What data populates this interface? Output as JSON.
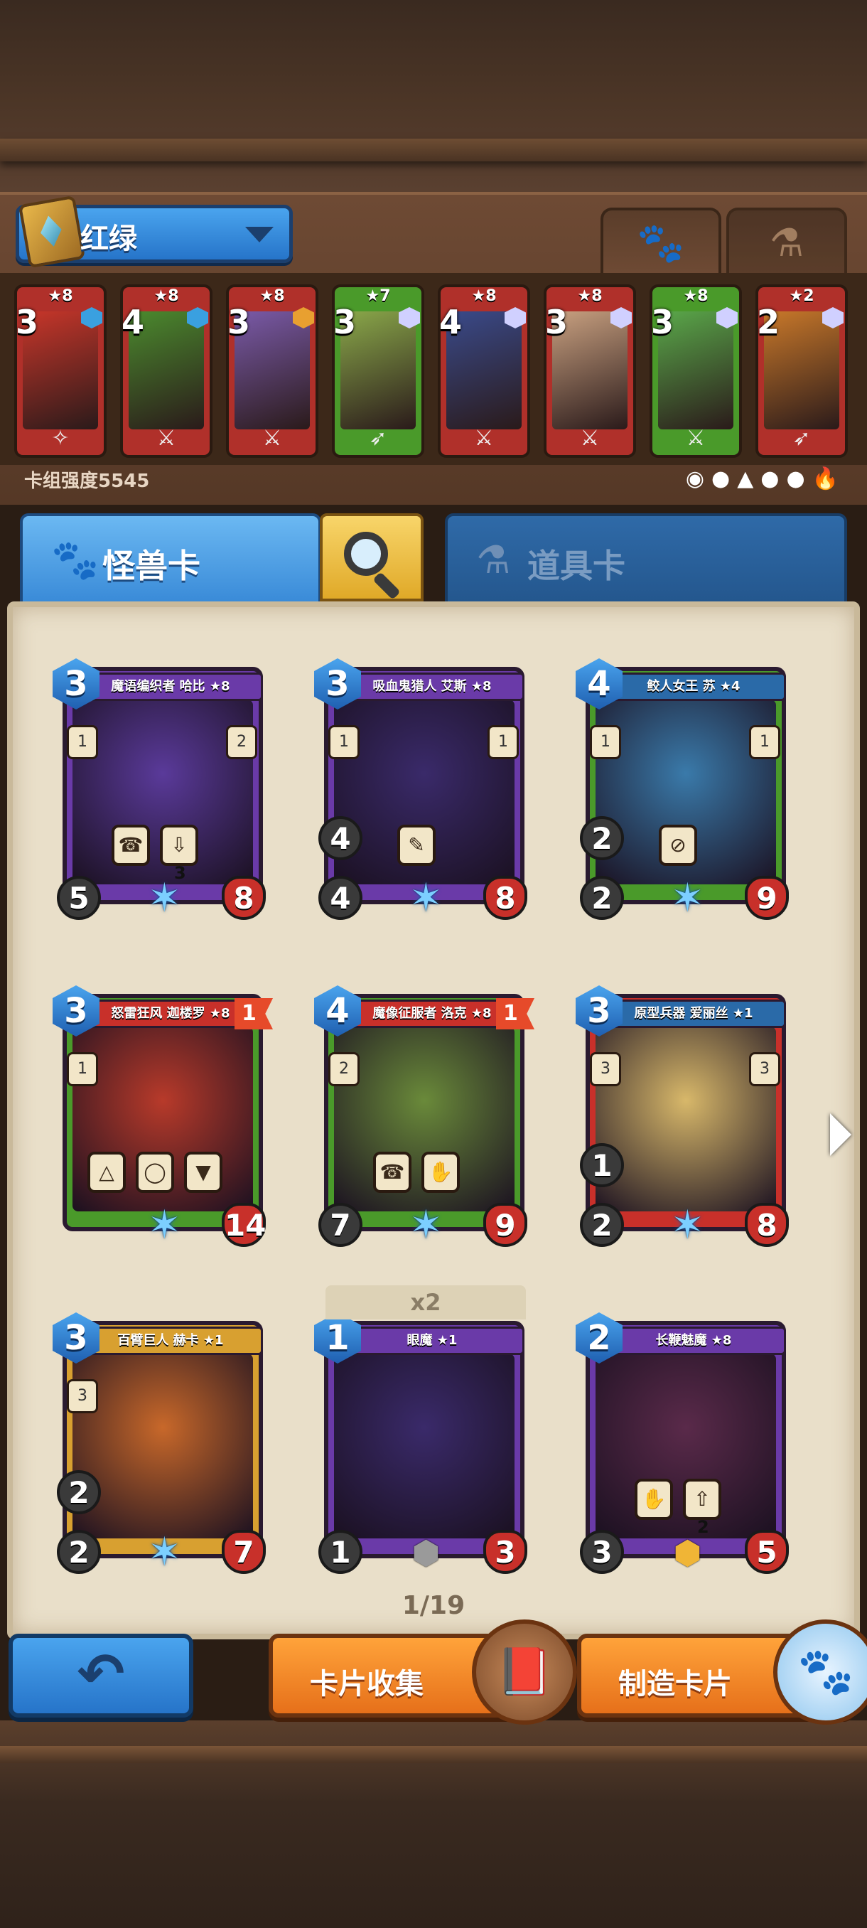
{
  "header": {
    "deck_name": "红绿",
    "tab_monster_icon": "paw-icon",
    "tab_item_icon": "potion-icon"
  },
  "deck": {
    "strength_label": "卡组强度5545",
    "cards": [
      {
        "stars": "★8",
        "cost": "3",
        "art_color": "#c8362a",
        "frame": "#b0302a",
        "gem": "#3aa0e0",
        "weapon": "paw"
      },
      {
        "stars": "★8",
        "cost": "4",
        "art_color": "#4b8a2e",
        "frame": "#b0302a",
        "gem": "#3aa0e0",
        "weapon": "sword"
      },
      {
        "stars": "★8",
        "cost": "3",
        "art_color": "#7a5aa8",
        "frame": "#b0302a",
        "gem": "#e8a030",
        "weapon": "sword"
      },
      {
        "stars": "★7",
        "cost": "3",
        "art_color": "#8aa84a",
        "frame": "#4a9a2a",
        "gem": "#d0d0ff",
        "weapon": "bow"
      },
      {
        "stars": "★8",
        "cost": "4",
        "art_color": "#3a4a8a",
        "frame": "#b0302a",
        "gem": "#d0d0ff",
        "weapon": "sword"
      },
      {
        "stars": "★8",
        "cost": "3",
        "art_color": "#c8a080",
        "frame": "#b0302a",
        "gem": "#d0d0ff",
        "weapon": "sword"
      },
      {
        "stars": "★8",
        "cost": "3",
        "art_color": "#5aa84a",
        "frame": "#4a9a2a",
        "gem": "#d0d0ff",
        "weapon": "sword"
      },
      {
        "stars": "★2",
        "cost": "2",
        "art_color": "#c8782a",
        "frame": "#b0302a",
        "gem": "#d0d0ff",
        "weapon": "bow"
      }
    ],
    "element_icons": [
      "◉",
      "●",
      "▲",
      "●",
      "●",
      "🔥"
    ]
  },
  "categories": {
    "monster_label": "怪兽卡",
    "item_label": "道具卡"
  },
  "cards": [
    {
      "name": "魔语编织者 哈比 ★8",
      "cost": "3",
      "atk": "5",
      "hp": "8",
      "extra": "",
      "side_l": "1",
      "side_r": "2",
      "banner": "#6a3aa8",
      "frame": "#6a3aa8",
      "art": "#5a3a9a",
      "abilities": [
        "☎",
        "⇩"
      ],
      "abil_num": "3",
      "flag": "",
      "rarity": "star"
    },
    {
      "name": "吸血鬼猎人 艾斯 ★8",
      "cost": "3",
      "atk": "4",
      "hp": "8",
      "extra": "4",
      "side_l": "1",
      "side_r": "1",
      "banner": "#6a3aa8",
      "frame": "#6a3aa8",
      "art": "#3a2a6a",
      "abilities": [
        "✎"
      ],
      "abil_num": "",
      "flag": "",
      "rarity": "star"
    },
    {
      "name": "鲛人女王 苏 ★4",
      "cost": "4",
      "atk": "2",
      "hp": "9",
      "extra": "2",
      "side_l": "1",
      "side_r": "1",
      "banner": "#2a6aa8",
      "frame": "#4a9a2a",
      "art": "#3a7aaa",
      "abilities": [
        "⊘"
      ],
      "abil_num": "",
      "flag": "",
      "rarity": "star"
    },
    {
      "name": "怒雷狂风 迦楼罗 ★8",
      "cost": "3",
      "atk": "",
      "hp": "14",
      "extra": "",
      "side_l": "1",
      "side_r": "",
      "banner": "#c8302a",
      "frame": "#4a9a2a",
      "art": "#b83a2a",
      "abilities": [
        "△",
        "◯",
        "▼"
      ],
      "abil_num": "",
      "flag": "1",
      "rarity": "star"
    },
    {
      "name": "魔像征服者 洛克 ★8",
      "cost": "4",
      "atk": "7",
      "hp": "9",
      "extra": "",
      "side_l": "2",
      "side_r": "",
      "banner": "#c8302a",
      "frame": "#4a9a2a",
      "art": "#6a8a3a",
      "abilities": [
        "☎",
        "✋"
      ],
      "abil_num": "",
      "flag": "1",
      "rarity": "star"
    },
    {
      "name": "原型兵器 爱丽丝 ★1",
      "cost": "3",
      "atk": "2",
      "hp": "8",
      "extra": "1",
      "side_l": "3",
      "side_r": "3",
      "banner": "#2a6aa8",
      "frame": "#c8302a",
      "art": "#d8b86a",
      "abilities": [],
      "abil_num": "",
      "flag": "",
      "rarity": "star"
    },
    {
      "name": "百臂巨人 赫卡 ★1",
      "cost": "3",
      "atk": "2",
      "hp": "7",
      "extra": "2",
      "side_l": "3",
      "side_r": "",
      "banner": "#d8a030",
      "frame": "#d8a030",
      "art": "#c8682a",
      "abilities": [],
      "abil_num": "",
      "flag": "",
      "rarity": "star"
    },
    {
      "name": "眼魔 ★1",
      "cost": "1",
      "atk": "1",
      "hp": "3",
      "extra": "",
      "side_l": "",
      "side_r": "",
      "banner": "#6a3aa8",
      "frame": "#6a3aa8",
      "art": "#3a2a6a",
      "abilities": [],
      "abil_num": "",
      "flag": "",
      "rarity": "grey"
    },
    {
      "name": "长鞭魅魔 ★8",
      "cost": "2",
      "atk": "3",
      "hp": "5",
      "extra": "",
      "side_l": "",
      "side_r": "",
      "banner": "#6a3aa8",
      "frame": "#6a3aa8",
      "art": "#5a2a4a",
      "abilities": [
        "✋",
        "⇧"
      ],
      "abil_num": "2",
      "flag": "",
      "rarity": "gold"
    }
  ],
  "duplicate_badge": "x2",
  "pagination": "1/19",
  "footer": {
    "back_icon": "back-arrow-icon",
    "collect_label": "卡片收集",
    "craft_label": "制造卡片"
  }
}
